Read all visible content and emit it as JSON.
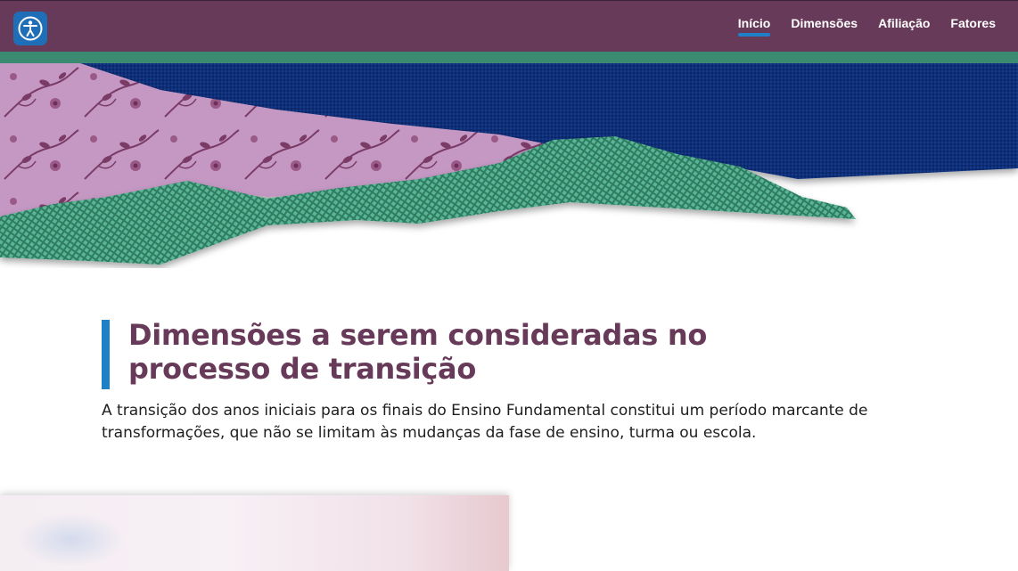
{
  "header": {
    "logo_icon": "accessibility-person-icon",
    "nav": [
      {
        "label": "Início",
        "active": true
      },
      {
        "label": "Dimensões",
        "active": false
      },
      {
        "label": "Afiliação",
        "active": false
      },
      {
        "label": "Fatores",
        "active": false
      }
    ]
  },
  "main": {
    "title": "Dimensões a serem consideradas no processo de transição",
    "intro": "A transição dos anos iniciais para os finais do Ensino Fundamental constitui um período marcante de transformações, que não se limitam às mudanças da fase de ensino, turma ou escola."
  },
  "colors": {
    "header_bg": "#683a59",
    "accent_blue": "#1f7fc7",
    "strip_green": "#3b8a72",
    "fabric_navy": "#0b2d78",
    "fabric_pink": "#c498c3",
    "fabric_green": "#4aa487",
    "title_color": "#683a59"
  }
}
